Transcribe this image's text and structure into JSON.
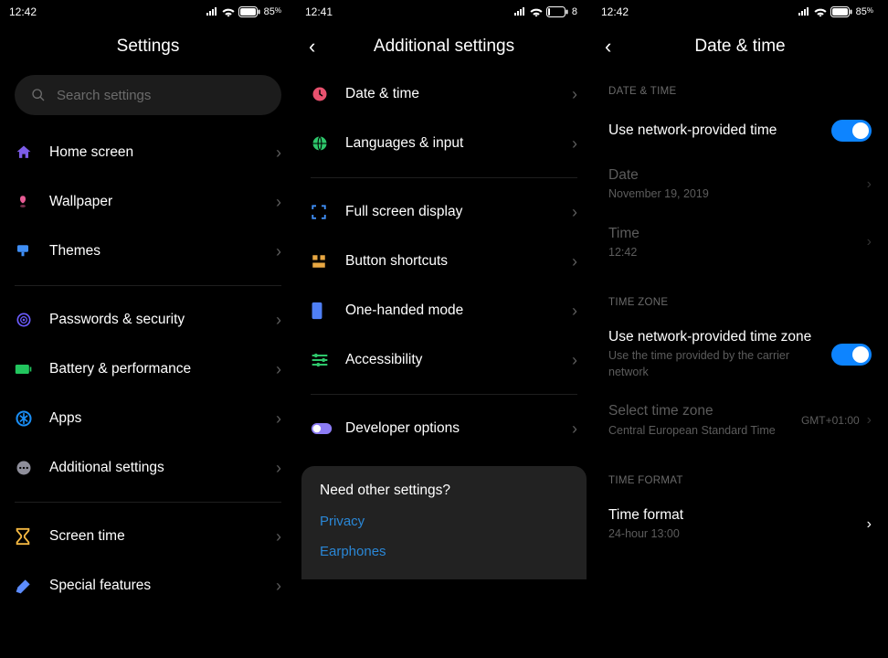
{
  "screens": [
    {
      "status": {
        "time": "12:42",
        "battery": "85"
      },
      "title": "Settings",
      "search_placeholder": "Search settings",
      "groups": [
        [
          {
            "icon": "home",
            "color": "#7c5ce8",
            "label": "Home screen"
          },
          {
            "icon": "wallpaper",
            "color": "#e85c95",
            "label": "Wallpaper"
          },
          {
            "icon": "themes",
            "color": "#3f8ef5",
            "label": "Themes"
          }
        ],
        [
          {
            "icon": "security",
            "color": "#6c5cff",
            "label": "Passwords & security"
          },
          {
            "icon": "battery",
            "color": "#22c55e",
            "label": "Battery & performance"
          },
          {
            "icon": "apps",
            "color": "#1a8ef5",
            "label": "Apps"
          },
          {
            "icon": "additional",
            "color": "#8e8e9a",
            "label": "Additional settings"
          }
        ],
        [
          {
            "icon": "screentime",
            "color": "#f5b942",
            "label": "Screen time"
          },
          {
            "icon": "special",
            "color": "#5c8cff",
            "label": "Special features"
          }
        ]
      ]
    },
    {
      "status": {
        "time": "12:41",
        "battery": "8"
      },
      "title": "Additional settings",
      "groups": [
        [
          {
            "icon": "datetime",
            "color": "#e8516e",
            "label": "Date & time"
          },
          {
            "icon": "languages",
            "color": "#2ec76b",
            "label": "Languages & input"
          }
        ],
        [
          {
            "icon": "fullscreen",
            "color": "#3f8ef5",
            "label": "Full screen display"
          },
          {
            "icon": "shortcuts",
            "color": "#e8a742",
            "label": "Button shortcuts"
          },
          {
            "icon": "onehanded",
            "color": "#4f7ff5",
            "label": "One-handed mode"
          },
          {
            "icon": "accessibility",
            "color": "#2ec76b",
            "label": "Accessibility"
          }
        ],
        [
          {
            "icon": "developer",
            "color": "#8c7cf5",
            "label": "Developer options"
          }
        ]
      ],
      "card": {
        "title": "Need other settings?",
        "links": [
          "Privacy",
          "Earphones"
        ]
      }
    },
    {
      "status": {
        "time": "12:42",
        "battery": "85"
      },
      "title": "Date & time",
      "sections": [
        {
          "header": "DATE & TIME",
          "items": [
            {
              "type": "toggle",
              "primary": "Use network-provided time",
              "on": true
            },
            {
              "type": "nav",
              "disabled": true,
              "primary": "Date",
              "secondary": "November 19, 2019"
            },
            {
              "type": "nav",
              "disabled": true,
              "primary": "Time",
              "secondary": "12:42"
            }
          ]
        },
        {
          "header": "TIME ZONE",
          "items": [
            {
              "type": "toggle",
              "primary": "Use network-provided time zone",
              "secondary": "Use the time provided by the carrier network",
              "on": true
            },
            {
              "type": "nav",
              "disabled": true,
              "primary": "Select time zone",
              "secondary": "Central European Standard Time",
              "right": "GMT+01:00"
            }
          ]
        },
        {
          "header": "TIME FORMAT",
          "items": [
            {
              "type": "nav",
              "primary": "Time format",
              "secondary": "24-hour 13:00"
            }
          ]
        }
      ]
    }
  ]
}
